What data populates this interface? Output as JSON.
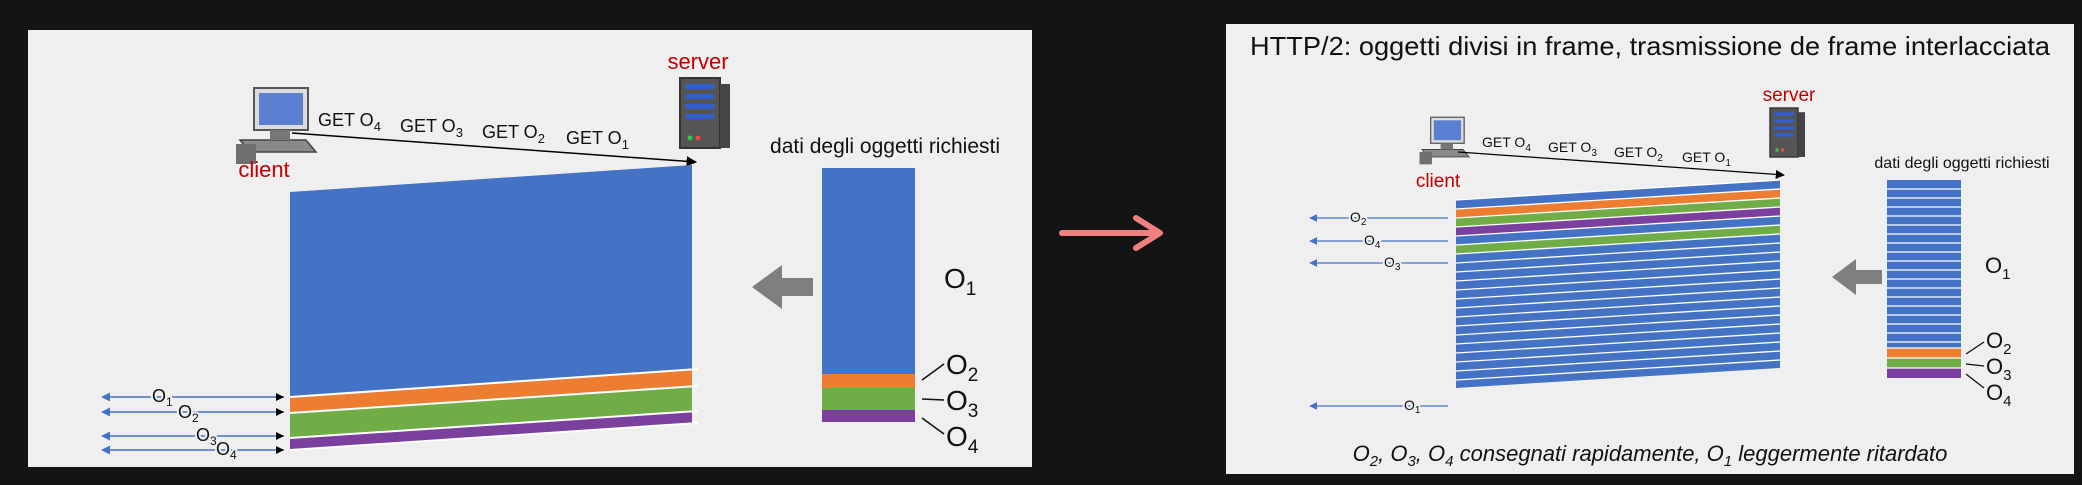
{
  "colors": {
    "page_bg": "#141414",
    "panel_bg": "#efefef",
    "o1": "#4472c4",
    "o2": "#ed7d31",
    "o3": "#70ad47",
    "o4": "#7b3f9e",
    "label_red": "#c00000",
    "transition_arrow": "#f08080",
    "gray_arrow": "#7f7f7f"
  },
  "left_panel": {
    "server_label": "server",
    "client_label": "client",
    "requests": [
      {
        "verb": "GET O",
        "sub": "4"
      },
      {
        "verb": "GET O",
        "sub": "3"
      },
      {
        "verb": "GET O",
        "sub": "2"
      },
      {
        "verb": "GET O",
        "sub": "1"
      }
    ],
    "objects_caption": "dati degli oggetti richiesti",
    "object_labels": [
      {
        "name": "O",
        "sub": "1"
      },
      {
        "name": "O",
        "sub": "2"
      },
      {
        "name": "O",
        "sub": "3"
      },
      {
        "name": "O",
        "sub": "4"
      }
    ],
    "arrival_labels": [
      {
        "name": "O",
        "sub": "1"
      },
      {
        "name": "O",
        "sub": "2"
      },
      {
        "name": "O",
        "sub": "3"
      },
      {
        "name": "O",
        "sub": "4"
      }
    ]
  },
  "right_panel": {
    "title": "HTTP/2: oggetti divisi in frame, trasmissione de frame interlacciata",
    "server_label": "server",
    "client_label": "client",
    "requests": [
      {
        "verb": "GET O",
        "sub": "4"
      },
      {
        "verb": "GET O",
        "sub": "3"
      },
      {
        "verb": "GET O",
        "sub": "2"
      },
      {
        "verb": "GET O",
        "sub": "1"
      }
    ],
    "objects_caption": "dati degli oggetti richiesti",
    "object_labels": [
      {
        "name": "O",
        "sub": "1"
      },
      {
        "name": "O",
        "sub": "2"
      },
      {
        "name": "O",
        "sub": "3"
      },
      {
        "name": "O",
        "sub": "4"
      }
    ],
    "arrival_labels": [
      {
        "name": "O",
        "sub": "2"
      },
      {
        "name": "O",
        "sub": "4"
      },
      {
        "name": "O",
        "sub": "3"
      },
      {
        "name": "O",
        "sub": "1"
      }
    ],
    "footer": {
      "parts": [
        {
          "name": "O",
          "sub": "2",
          "after": ", "
        },
        {
          "name": "O",
          "sub": "3",
          "after": ", "
        },
        {
          "name": "O",
          "sub": "4",
          "after": " consegnati rapidamente, "
        },
        {
          "name": "O",
          "sub": "1",
          "after": " leggermente ritardato"
        }
      ]
    }
  }
}
